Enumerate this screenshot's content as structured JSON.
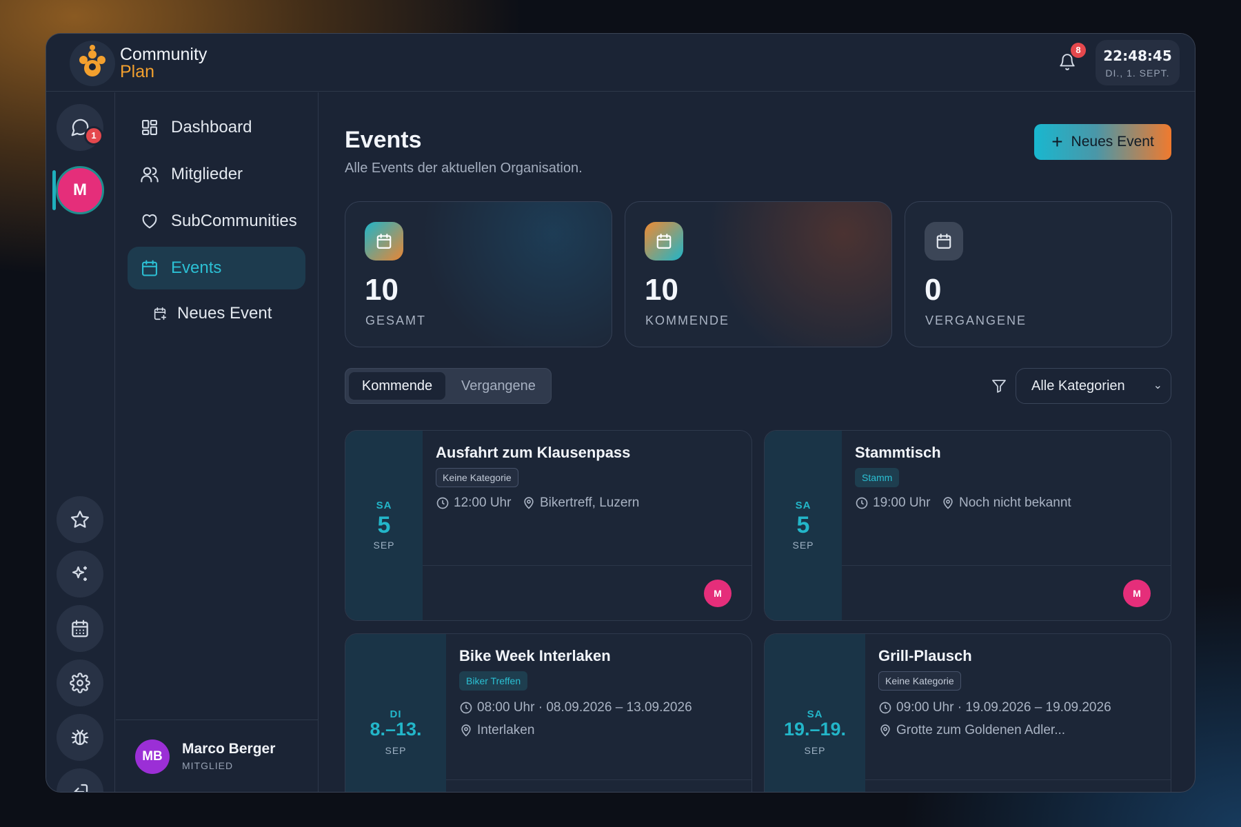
{
  "app": {
    "name_line1": "Community",
    "name_line2": "Plan"
  },
  "header": {
    "notif_count": "8",
    "time": "22:48:45",
    "date": "DI., 1. SEPT."
  },
  "rail": {
    "chat_badge": "1",
    "org_avatar": "M"
  },
  "nav": {
    "items": [
      {
        "label": "Dashboard",
        "icon": "dashboard-icon"
      },
      {
        "label": "Mitglieder",
        "icon": "users-icon"
      },
      {
        "label": "SubCommunities",
        "icon": "heart-icon"
      },
      {
        "label": "Events",
        "icon": "calendar-icon",
        "active": true
      },
      {
        "label": "Neues Event",
        "icon": "calendar-plus-icon",
        "sub": true
      }
    ]
  },
  "user": {
    "initials": "MB",
    "name": "Marco Berger",
    "role": "MITGLIED"
  },
  "page": {
    "title": "Events",
    "subtitle": "Alle Events der aktuellen Organisation.",
    "new_button": "Neues Event"
  },
  "stats": [
    {
      "value": "10",
      "label": "GESAMT"
    },
    {
      "value": "10",
      "label": "KOMMENDE"
    },
    {
      "value": "0",
      "label": "VERGANGENE"
    }
  ],
  "tabs": {
    "active": "Kommende",
    "inactive": "Vergangene"
  },
  "filter": {
    "selected": "Alle Kategorien"
  },
  "events": [
    {
      "weekday": "SA",
      "day": "5",
      "month": "SEP",
      "title": "Ausfahrt zum Klausenpass",
      "tag": "Keine Kategorie",
      "time": "12:00 Uhr",
      "location": "Bikertreff, Luzern",
      "avatar": "M"
    },
    {
      "weekday": "SA",
      "day": "5",
      "month": "SEP",
      "title": "Stammtisch",
      "tag": "Stamm",
      "time": "19:00 Uhr",
      "location": "Noch nicht bekannt",
      "avatar": "M"
    },
    {
      "weekday": "DI",
      "day": "8.–13.",
      "month": "SEP",
      "title": "Bike Week Interlaken",
      "tag": "Biker Treffen",
      "time": "08:00 Uhr · 08.09.2026 – 13.09.2026",
      "location": "Interlaken"
    },
    {
      "weekday": "SA",
      "day": "19.–19.",
      "month": "SEP",
      "title": "Grill-Plausch",
      "tag": "Keine Kategorie",
      "time": "09:00 Uhr · 19.09.2026 – 19.09.2026",
      "location": "Grotte zum Goldenen Adler..."
    }
  ],
  "colors": {
    "accent": "#23b6c9",
    "brand_orange": "#f3a02e",
    "avatar_pink": "#e52e7a",
    "badge_red": "#e5484d"
  }
}
